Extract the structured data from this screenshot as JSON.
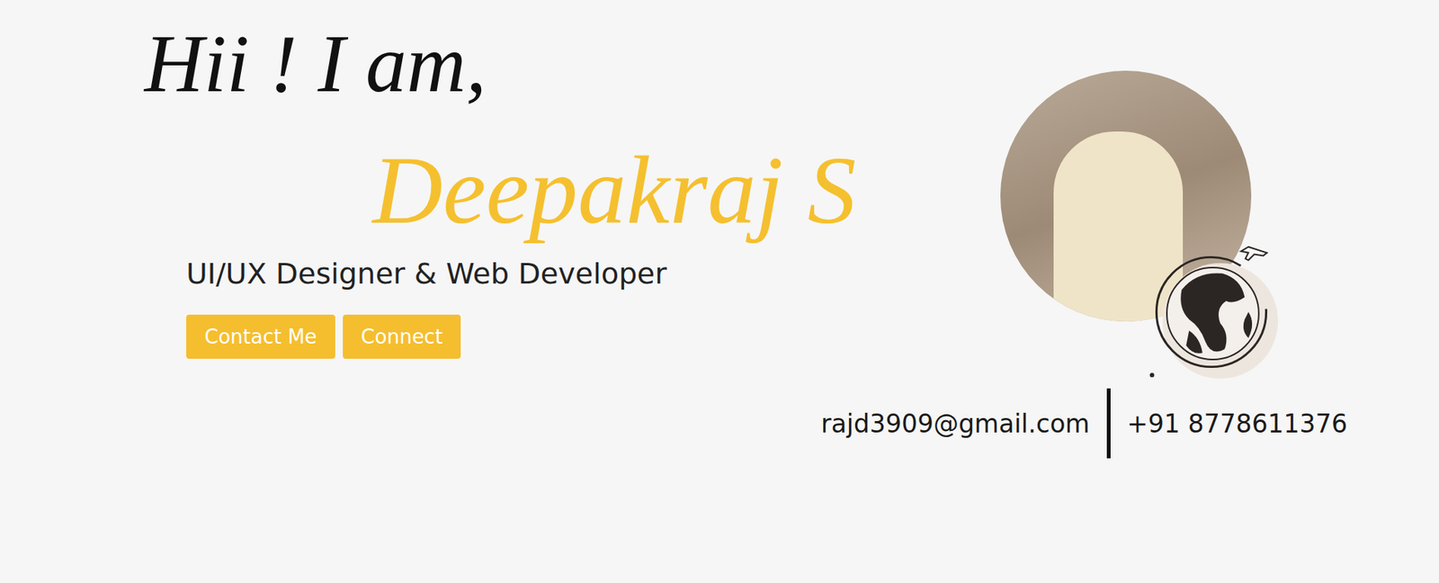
{
  "greeting": "Hii ! I am,",
  "name": "Deepakraj S",
  "role": "UI/UX Designer & Web Developer",
  "buttons": [
    {
      "label": "Contact Me"
    },
    {
      "label": "Connect"
    }
  ],
  "contact": {
    "email": "rajd3909@gmail.com",
    "phone": "+91 8778611376"
  }
}
